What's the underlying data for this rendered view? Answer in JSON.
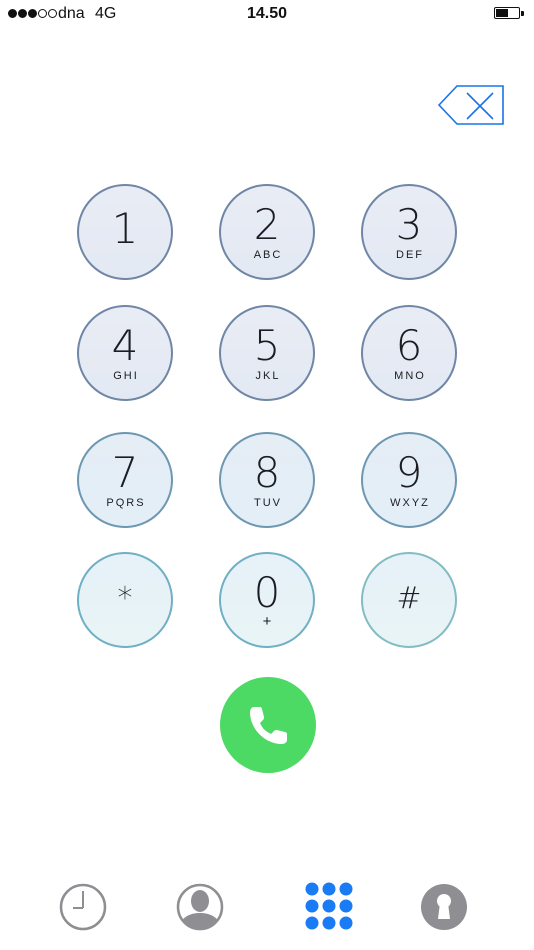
{
  "status_bar": {
    "signal_filled": 3,
    "signal_total": 5,
    "carrier": "dna",
    "network": "4G",
    "time": "14.50",
    "battery_level": 0.55
  },
  "delete": {
    "icon": "delete-backspace-icon",
    "color": "#1a73e8"
  },
  "keypad": {
    "keys": [
      {
        "digit": "1",
        "letters": ""
      },
      {
        "digit": "2",
        "letters": "ABC"
      },
      {
        "digit": "3",
        "letters": "DEF"
      },
      {
        "digit": "4",
        "letters": "GHI"
      },
      {
        "digit": "5",
        "letters": "JKL"
      },
      {
        "digit": "6",
        "letters": "MNO"
      },
      {
        "digit": "7",
        "letters": "PQRS"
      },
      {
        "digit": "8",
        "letters": "TUV"
      },
      {
        "digit": "9",
        "letters": "WXYZ"
      },
      {
        "digit": "*",
        "letters": ""
      },
      {
        "digit": "0",
        "letters": "+"
      },
      {
        "digit": "#",
        "letters": ""
      }
    ]
  },
  "call": {
    "icon": "phone-icon",
    "color": "#4cd964"
  },
  "tab_bar": {
    "tabs": [
      {
        "icon": "recents-clock-icon",
        "selected": false
      },
      {
        "icon": "contacts-person-icon",
        "selected": false
      },
      {
        "icon": "keypad-grid-icon",
        "selected": true
      },
      {
        "icon": "voicemail-keyhole-icon",
        "selected": false
      }
    ],
    "active_color": "#1a7cf5",
    "inactive_color": "#8e8e93"
  }
}
